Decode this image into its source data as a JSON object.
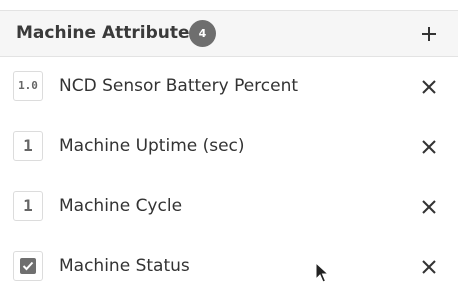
{
  "panel": {
    "title": "Machine Attributes",
    "count": "4",
    "add_icon": "plus-icon"
  },
  "attributes": [
    {
      "type_glyph": "1.0",
      "type_icon": "decimal-type-icon",
      "label": "NCD Sensor Battery Percent",
      "remove_icon": "close-icon"
    },
    {
      "type_glyph": "1",
      "type_icon": "integer-type-icon",
      "label": "Machine Uptime (sec)",
      "remove_icon": "close-icon"
    },
    {
      "type_glyph": "1",
      "type_icon": "integer-type-icon",
      "label": "Machine Cycle",
      "remove_icon": "close-icon"
    },
    {
      "type_glyph": "",
      "type_icon": "checkbox-type-icon",
      "label": "Machine Status",
      "remove_icon": "close-icon"
    }
  ],
  "colors": {
    "header_background": "#f6f6f6",
    "badge_background": "#6e6e6e",
    "icon": "#333333",
    "checkbox_fill": "#6f6f6f"
  }
}
